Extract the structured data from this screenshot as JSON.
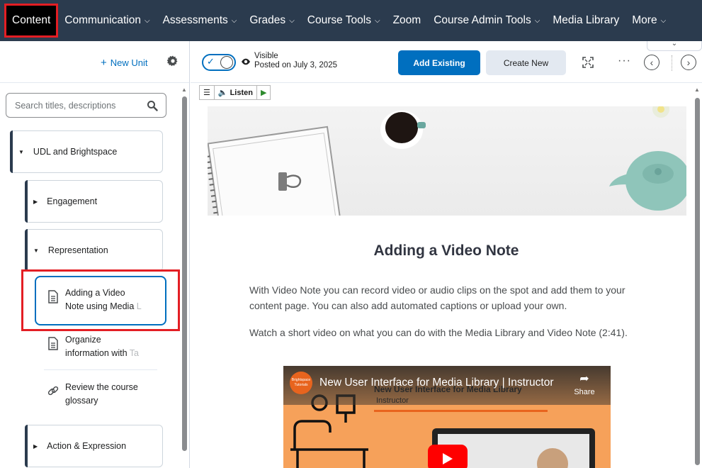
{
  "nav": {
    "items": [
      {
        "label": "Content",
        "dropdown": false,
        "active": true
      },
      {
        "label": "Communication",
        "dropdown": true
      },
      {
        "label": "Assessments",
        "dropdown": true
      },
      {
        "label": "Grades",
        "dropdown": true
      },
      {
        "label": "Course Tools",
        "dropdown": true
      },
      {
        "label": "Zoom",
        "dropdown": false
      },
      {
        "label": "Course Admin Tools",
        "dropdown": true
      },
      {
        "label": "Media Library",
        "dropdown": false
      },
      {
        "label": "More",
        "dropdown": true
      }
    ],
    "bg_color": "#2b3b4e",
    "highlight_color": "#e31e24"
  },
  "left_panel": {
    "new_unit_label": "New Unit",
    "search_placeholder": "Search titles, descriptions",
    "units": [
      {
        "label": "UDL and Brightspace",
        "expanded": true
      },
      {
        "label": "Engagement",
        "expanded": false
      },
      {
        "label": "Representation",
        "expanded": true
      },
      {
        "label": "Action & Expression",
        "expanded": false
      }
    ],
    "topics": [
      {
        "line1": "Adding a Video",
        "line2_visible": "Note using Media ",
        "line2_faded": "L",
        "icon": "document-icon",
        "selected": true
      },
      {
        "line1": "Organize",
        "line2_visible": "information with ",
        "line2_faded": "Ta",
        "icon": "document-icon",
        "selected": false
      },
      {
        "line1": "Review the course",
        "line2_visible": "glossary",
        "line2_faded": "",
        "icon": "link-icon",
        "selected": false
      }
    ]
  },
  "toolbar": {
    "visibility_label": "Visible",
    "posted_label": "Posted on July 3, 2025",
    "add_existing_label": "Add Existing",
    "create_new_label": "Create New",
    "more_label": "···"
  },
  "readspeaker": {
    "listen_label": "Listen"
  },
  "content": {
    "title": "Adding a Video Note",
    "paragraph1": "With Video Note you can record video or audio clips on the spot and add them to your content page.  You can also add automated captions or upload your own.",
    "paragraph2": "Watch a short video on what you can do with the Media Library and Video Note (2:41)."
  },
  "video": {
    "title": "New User Interface for Media Library | Instructor",
    "slide_title": "New User Interface for Media Library",
    "slide_subtitle": "Instructor",
    "share_label": "Share",
    "channel_logo_text": "Brightspace Tutorials"
  },
  "colors": {
    "accent": "#006fbf",
    "red_annotation": "#e31e24",
    "video_bg": "#f6a15a"
  }
}
